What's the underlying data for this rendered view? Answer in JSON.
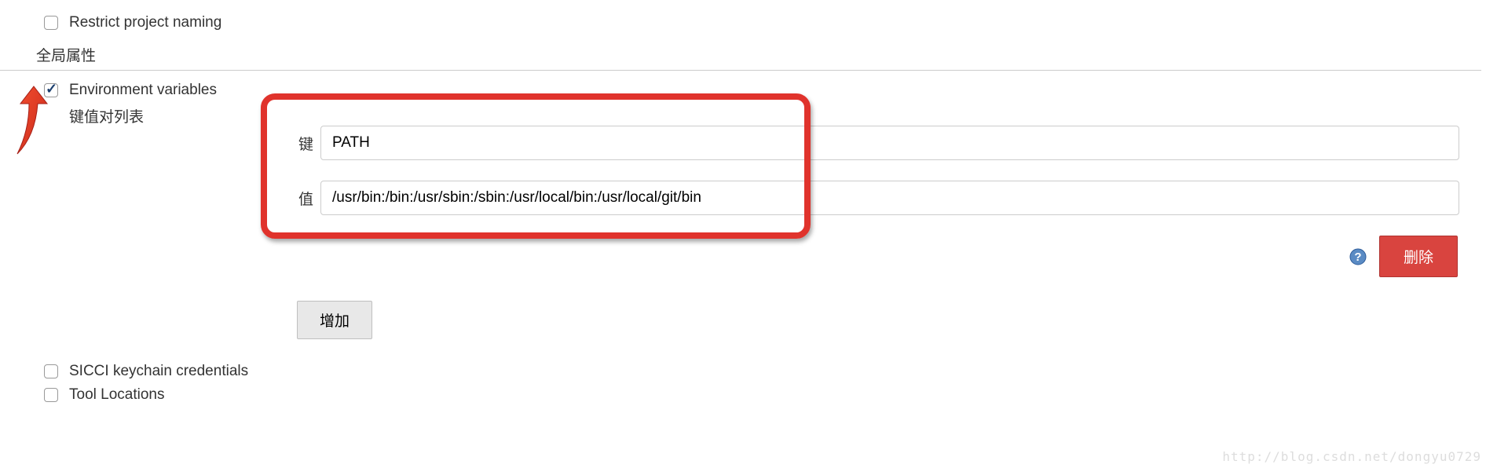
{
  "options": {
    "restrict_naming": {
      "label": "Restrict project naming",
      "checked": false
    },
    "env_vars": {
      "label": "Environment variables",
      "checked": true
    },
    "sicci": {
      "label": "SICCI keychain credentials",
      "checked": false
    },
    "tool_locations": {
      "label": "Tool Locations",
      "checked": false
    }
  },
  "section_header": "全局属性",
  "kv": {
    "list_label": "键值对列表",
    "key_label": "键",
    "value_label": "值",
    "key_value": "PATH",
    "value_value": "/usr/bin:/bin:/usr/sbin:/sbin:/usr/local/bin:/usr/local/git/bin"
  },
  "buttons": {
    "delete": "删除",
    "add": "增加"
  },
  "watermark": "http://blog.csdn.net/dongyu0729"
}
